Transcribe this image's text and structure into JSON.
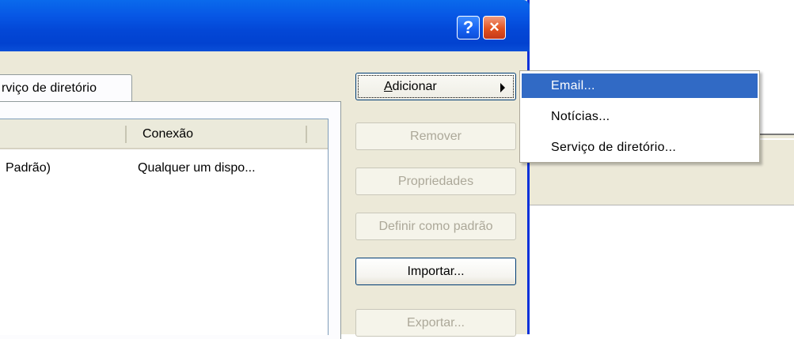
{
  "titlebar": {
    "help_label": "?",
    "close_label": "✕"
  },
  "tab": {
    "label": "rviço de diretório"
  },
  "list": {
    "columns": [
      "Conexão"
    ],
    "rows": [
      {
        "name": "Padrão)",
        "connection": "Qualquer um dispo..."
      }
    ]
  },
  "buttons": {
    "add": "dicionar",
    "add_accel": "A",
    "remove": "Remover",
    "properties": "Propriedades",
    "set_default": "Definir como padrão",
    "import": "Importar...",
    "export": "Exportar..."
  },
  "menu": {
    "items": [
      "Email...",
      "Notícias...",
      "Serviço de diretório..."
    ],
    "selected_index": 0
  },
  "colors": {
    "titlebar": "#0347d6",
    "menu_highlight": "#316ac5",
    "dialog_bg": "#ece9d8"
  }
}
